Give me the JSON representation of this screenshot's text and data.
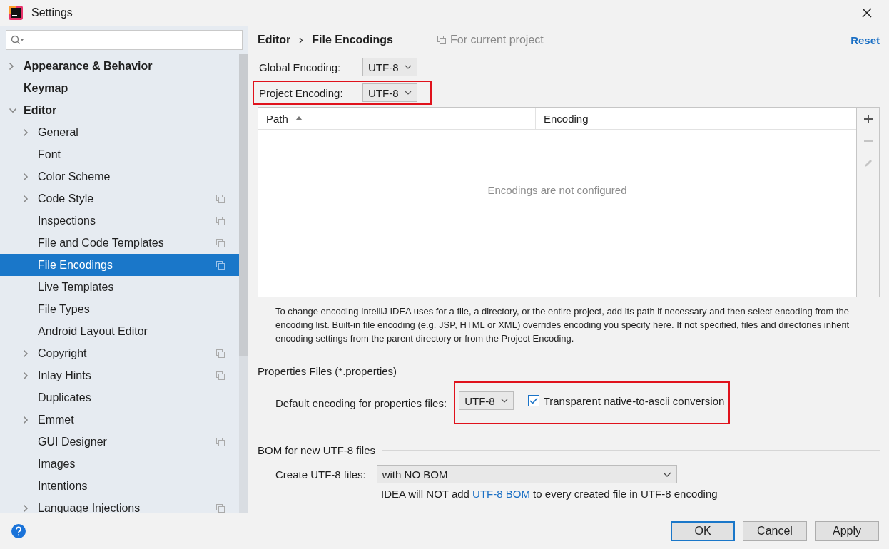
{
  "window": {
    "title": "Settings"
  },
  "sidebar": {
    "items": [
      {
        "label": "Appearance & Behavior",
        "kind": "node",
        "expanded": false,
        "selected": false,
        "project_scoped": false
      },
      {
        "label": "Keymap",
        "kind": "leaf",
        "selected": false,
        "project_scoped": false
      },
      {
        "label": "Editor",
        "kind": "node",
        "expanded": true,
        "selected": false,
        "project_scoped": false,
        "children": [
          {
            "label": "General",
            "kind": "node",
            "expanded": false,
            "selected": false,
            "project_scoped": false
          },
          {
            "label": "Font",
            "kind": "leaf",
            "selected": false,
            "project_scoped": false
          },
          {
            "label": "Color Scheme",
            "kind": "node",
            "expanded": false,
            "selected": false,
            "project_scoped": false
          },
          {
            "label": "Code Style",
            "kind": "node",
            "expanded": false,
            "selected": false,
            "project_scoped": true
          },
          {
            "label": "Inspections",
            "kind": "leaf",
            "selected": false,
            "project_scoped": true
          },
          {
            "label": "File and Code Templates",
            "kind": "leaf",
            "selected": false,
            "project_scoped": true
          },
          {
            "label": "File Encodings",
            "kind": "leaf",
            "selected": true,
            "project_scoped": true
          },
          {
            "label": "Live Templates",
            "kind": "leaf",
            "selected": false,
            "project_scoped": false
          },
          {
            "label": "File Types",
            "kind": "leaf",
            "selected": false,
            "project_scoped": false
          },
          {
            "label": "Android Layout Editor",
            "kind": "leaf",
            "selected": false,
            "project_scoped": false
          },
          {
            "label": "Copyright",
            "kind": "node",
            "expanded": false,
            "selected": false,
            "project_scoped": true
          },
          {
            "label": "Inlay Hints",
            "kind": "node",
            "expanded": false,
            "selected": false,
            "project_scoped": true
          },
          {
            "label": "Duplicates",
            "kind": "leaf",
            "selected": false,
            "project_scoped": false
          },
          {
            "label": "Emmet",
            "kind": "node",
            "expanded": false,
            "selected": false,
            "project_scoped": false
          },
          {
            "label": "GUI Designer",
            "kind": "leaf",
            "selected": false,
            "project_scoped": true
          },
          {
            "label": "Images",
            "kind": "leaf",
            "selected": false,
            "project_scoped": false
          },
          {
            "label": "Intentions",
            "kind": "leaf",
            "selected": false,
            "project_scoped": false
          },
          {
            "label": "Language Injections",
            "kind": "node",
            "expanded": false,
            "selected": false,
            "project_scoped": true
          }
        ]
      }
    ]
  },
  "breadcrumb": [
    "Editor",
    "File Encodings"
  ],
  "scope_label": "For current project",
  "reset_link": "Reset",
  "encodings": [
    {
      "label": "Global Encoding:",
      "value": "UTF-8",
      "highlighted": false
    },
    {
      "label": "Project Encoding:",
      "value": "UTF-8",
      "highlighted": true
    }
  ],
  "table": {
    "columns": [
      {
        "label": "Path",
        "sorted": true
      },
      {
        "label": "Encoding",
        "sorted": false
      }
    ],
    "empty_text": "Encodings are not configured",
    "tools": [
      {
        "kind": "add",
        "disabled": false
      },
      {
        "kind": "remove",
        "disabled": true
      },
      {
        "kind": "edit",
        "disabled": true
      }
    ]
  },
  "help_text": "To change encoding IntelliJ IDEA uses for a file, a directory, or the entire project, add its path if necessary and then select encoding from the encoding list. Built-in file encoding (e.g. JSP, HTML or XML) overrides encoding you specify here. If not specified, files and directories inherit encoding settings from the parent directory or from the Project Encoding.",
  "properties_section": {
    "title": "Properties Files (*.properties)",
    "label": "Default encoding for properties files:",
    "value": "UTF-8",
    "highlighted": true,
    "checkbox": {
      "label": "Transparent native-to-ascii conversion",
      "checked": true
    }
  },
  "bom_section": {
    "title": "BOM for new UTF-8 files",
    "label": "Create UTF-8 files:",
    "value": "with NO BOM",
    "note_before": "IDEA will NOT add ",
    "note_link": "UTF-8 BOM",
    "note_after": " to every created file in UTF-8 encoding"
  },
  "buttons": [
    {
      "label": "OK",
      "default": true
    },
    {
      "label": "Cancel",
      "default": false
    },
    {
      "label": "Apply",
      "default": false
    }
  ]
}
